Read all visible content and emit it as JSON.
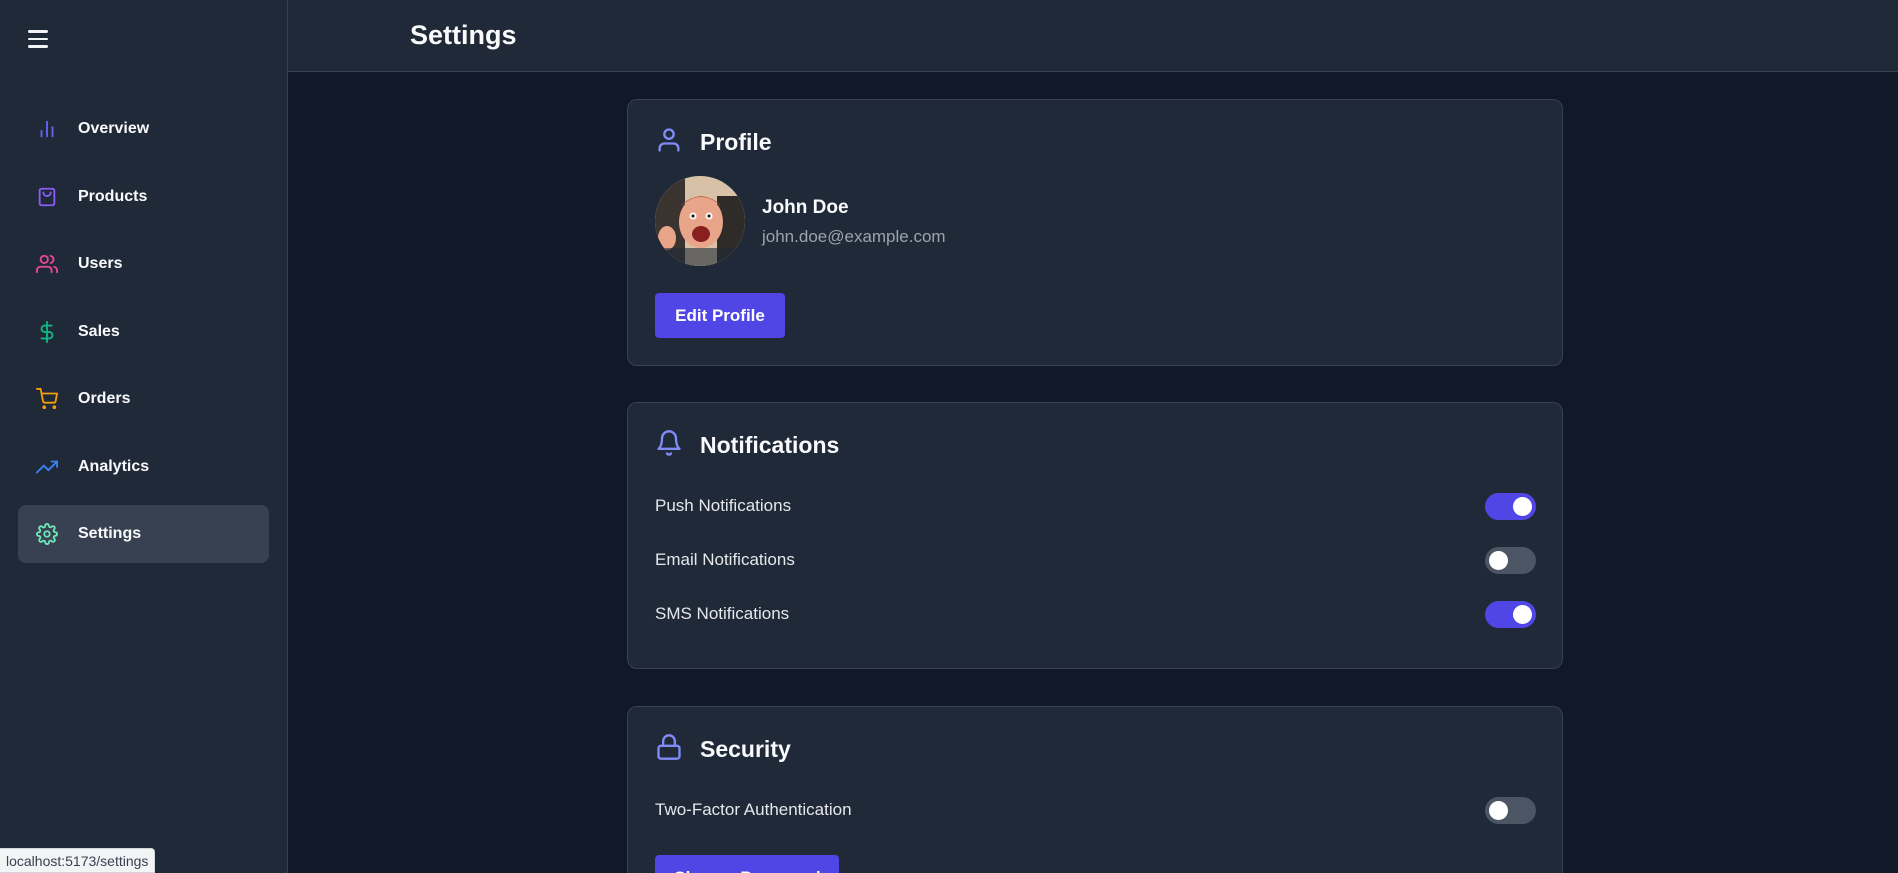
{
  "header": {
    "title": "Settings"
  },
  "sidebar": {
    "items": [
      {
        "label": "Overview",
        "icon": "bar-chart-icon",
        "color": "#6366f1",
        "active": false
      },
      {
        "label": "Products",
        "icon": "shopping-bag-icon",
        "color": "#8b5cf6",
        "active": false
      },
      {
        "label": "Users",
        "icon": "users-icon",
        "color": "#ec4899",
        "active": false
      },
      {
        "label": "Sales",
        "icon": "dollar-sign-icon",
        "color": "#10b981",
        "active": false
      },
      {
        "label": "Orders",
        "icon": "shopping-cart-icon",
        "color": "#f59e0b",
        "active": false
      },
      {
        "label": "Analytics",
        "icon": "trending-up-icon",
        "color": "#3b82f6",
        "active": false
      },
      {
        "label": "Settings",
        "icon": "gear-icon",
        "color": "#6ee7b7",
        "active": true
      }
    ]
  },
  "profile": {
    "title": "Profile",
    "name": "John Doe",
    "email": "john.doe@example.com",
    "edit_label": "Edit Profile"
  },
  "notifications": {
    "title": "Notifications",
    "items": [
      {
        "label": "Push Notifications",
        "on": true
      },
      {
        "label": "Email Notifications",
        "on": false
      },
      {
        "label": "SMS Notifications",
        "on": true
      }
    ]
  },
  "security": {
    "title": "Security",
    "two_factor_label": "Two-Factor Authentication",
    "two_factor_on": false,
    "change_password_label": "Change Password"
  },
  "status_bar": {
    "url": "localhost:5173/settings"
  },
  "colors": {
    "accent": "#4f46e5",
    "card_icon": "#818cf8",
    "background": "#111827",
    "panel": "#1f2937"
  }
}
